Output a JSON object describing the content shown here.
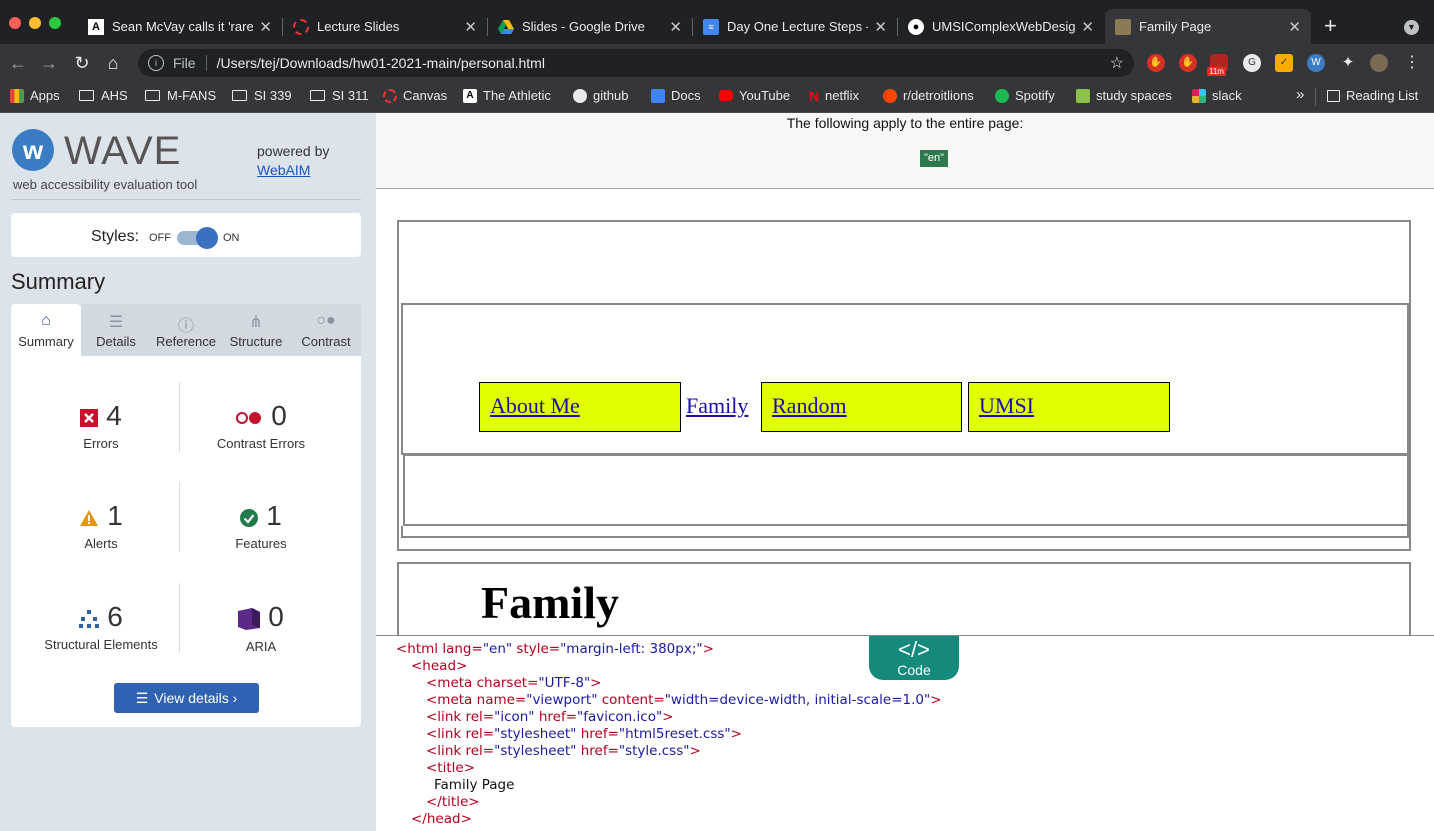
{
  "browser": {
    "tabs": [
      {
        "title": "Sean McVay calls it 'rare",
        "icon": "athletic-icon"
      },
      {
        "title": "Lecture Slides",
        "icon": "canvas-icon"
      },
      {
        "title": "Slides - Google Drive",
        "icon": "drive-icon"
      },
      {
        "title": "Day One Lecture Steps -",
        "icon": "docs-icon"
      },
      {
        "title": "UMSIComplexWebDesign",
        "icon": "github-icon"
      },
      {
        "title": "Family Page",
        "icon": "page-icon"
      }
    ],
    "new_tab": "+",
    "url_scheme": "File",
    "url": "/Users/tej/Downloads/hw01-2021-main/personal.html",
    "ext_badge": "11m",
    "bookmarks": [
      "Apps",
      "AHS",
      "M-FANS",
      "SI 339",
      "SI 311",
      "Canvas",
      "The Athletic",
      "github",
      "Docs",
      "YouTube",
      "netflix",
      "r/detroitlions",
      "Spotify",
      "study spaces",
      "slack"
    ],
    "more": "»",
    "reading_list": "Reading List"
  },
  "wave": {
    "name": "WAVE",
    "tagline": "web accessibility evaluation tool",
    "powered_by": "powered by",
    "webaim": "WebAIM",
    "styles_label": "Styles:",
    "off": "OFF",
    "on": "ON",
    "summary_heading": "Summary",
    "tabs": [
      "Summary",
      "Details",
      "Reference",
      "Structure",
      "Contrast"
    ],
    "stats": {
      "errors": {
        "num": "4",
        "label": "Errors"
      },
      "contrast": {
        "num": "0",
        "label": "Contrast Errors"
      },
      "alerts": {
        "num": "1",
        "label": "Alerts"
      },
      "features": {
        "num": "1",
        "label": "Features"
      },
      "structural": {
        "num": "6",
        "label": "Structural Elements"
      },
      "aria": {
        "num": "0",
        "label": "ARIA"
      }
    },
    "view_details": "View details ›"
  },
  "page": {
    "apply_text": "The following apply to the entire page:",
    "lang_badge": "\"en\"",
    "nav": {
      "about": "About Me",
      "family": "Family",
      "random": "Random",
      "umsi": "UMSI"
    },
    "heading": "Family"
  },
  "code": {
    "button": "Code",
    "lines": {
      "l1_tag": "<html",
      "l1_attr": " lang=",
      "l1_val": "\"en\"",
      "l1_attr2": " style=",
      "l1_val2": "\"margin-left: 380px;\"",
      "l1_end": ">",
      "l2": "<head>",
      "l3_tag": "<meta",
      "l3_attr": " charset=",
      "l3_val": "\"UTF-8\"",
      "l3_end": ">",
      "l4_tag": "<meta",
      "l4_attr": " name=",
      "l4_val": "\"viewport\"",
      "l4_attr2": " content=",
      "l4_val2": "\"width=device-width, initial-scale=1.0\"",
      "l4_end": ">",
      "l5_tag": "<link",
      "l5_attr": " rel=",
      "l5_val": "\"icon\"",
      "l5_attr2": " href=",
      "l5_val2": "\"favicon.ico\"",
      "l5_end": ">",
      "l6_tag": "<link",
      "l6_attr": " rel=",
      "l6_val": "\"stylesheet\"",
      "l6_attr2": " href=",
      "l6_val2": "\"html5reset.css\"",
      "l6_end": ">",
      "l7_tag": "<link",
      "l7_attr": " rel=",
      "l7_val": "\"stylesheet\"",
      "l7_attr2": " href=",
      "l7_val2": "\"style.css\"",
      "l7_end": ">",
      "l8": "<title>",
      "l9": "Family Page",
      "l10": "</title>",
      "l11": "</head>"
    }
  }
}
